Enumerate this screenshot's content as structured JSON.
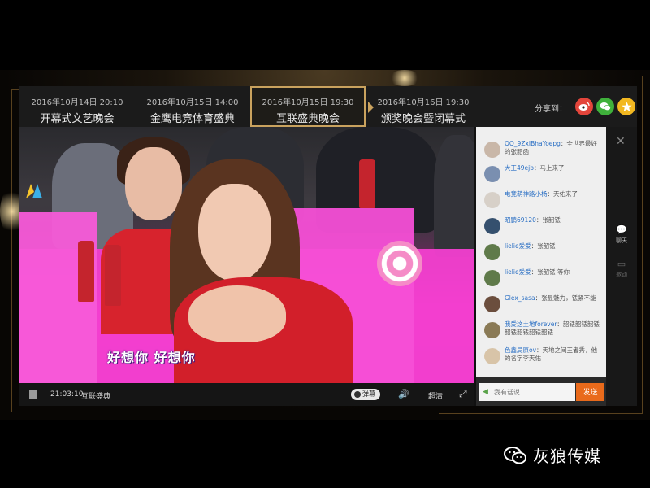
{
  "schedule_tabs": [
    {
      "date": "2016年10月14日 20:10",
      "name": "开幕式文艺晚会",
      "active": false
    },
    {
      "date": "2016年10月15日 14:00",
      "name": "金鹰电竞体育盛典",
      "active": false
    },
    {
      "date": "2016年10月15日 19:30",
      "name": "互联盛典晚会",
      "active": true
    },
    {
      "date": "2016年10月16日 19:30",
      "name": "颁奖晚会暨闭幕式",
      "active": false
    }
  ],
  "share": {
    "label": "分享到：",
    "buttons": [
      {
        "name": "weibo",
        "icon": "weibo-icon",
        "color": "#e3453b"
      },
      {
        "name": "wechat",
        "icon": "wechat-icon",
        "color": "#3fb13b"
      },
      {
        "name": "qzone",
        "icon": "qzone-icon",
        "color": "#f2b821"
      }
    ]
  },
  "video": {
    "subtitle": "好想你 好想你"
  },
  "controls": {
    "time": "21:03:10",
    "title": "互联盛典",
    "danmu_label": "弹幕",
    "quality_label": "超清"
  },
  "chat": {
    "messages": [
      {
        "user": "QQ_9ZxIBhaYoepg",
        "text": "：全世界最好的张韶函",
        "avatar_color": "#c9b7a8"
      },
      {
        "user": "大王49ejb",
        "text": "：马上来了",
        "avatar_color": "#7a8fb0"
      },
      {
        "user": "电竞萌神路小杨",
        "text": "：天佑来了",
        "avatar_color": "#d7d0c8"
      },
      {
        "user": "昭鹏69120",
        "text": "：张韶铥",
        "avatar_color": "#35506e"
      },
      {
        "user": "lielie爱爱",
        "text": "：张韶铥",
        "avatar_color": "#5f7a4a"
      },
      {
        "user": "lielie爱爱",
        "text": "：张韶铥 等你",
        "avatar_color": "#5f7a4a"
      },
      {
        "user": "Glex_sasa",
        "text": "：张显魅力，铥紧不能",
        "avatar_color": "#6b4e3d"
      },
      {
        "user": "我爱这土地forever",
        "text": "：韶铥韶铥韶铥韶铥韶铥韶铥韶铥",
        "avatar_color": "#8a7a56"
      },
      {
        "user": "色鑫局原ov",
        "text": "：天地之间王者秀，他的名字李天佑",
        "avatar_color": "#d8c4a8"
      }
    ],
    "input_placeholder": "我有话说",
    "send_label": "发送"
  },
  "rail": {
    "chat_label": "聊天",
    "other_label": "邀动"
  },
  "watermark": {
    "text": "灰狼传媒"
  },
  "colors": {
    "accent_gold": "#c9a25e",
    "send_orange": "#e96a1b",
    "stage_magenta": "#e62fc0"
  }
}
